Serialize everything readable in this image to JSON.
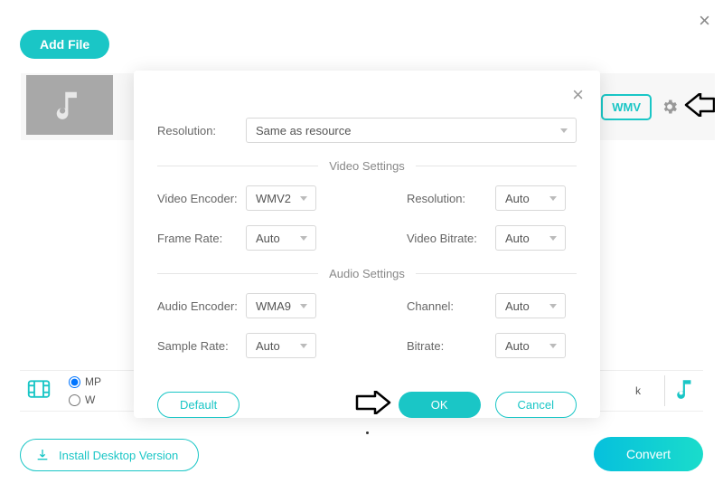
{
  "top": {
    "add_file": "Add File",
    "format_badge": "WMV"
  },
  "modal": {
    "resolution_label": "Resolution:",
    "resolution_value": "Same as resource",
    "video_section": "Video Settings",
    "video_encoder_label": "Video Encoder:",
    "video_encoder_value": "WMV2",
    "frame_rate_label": "Frame Rate:",
    "frame_rate_value": "Auto",
    "res2_label": "Resolution:",
    "res2_value": "Auto",
    "vbitrate_label": "Video Bitrate:",
    "vbitrate_value": "Auto",
    "audio_section": "Audio Settings",
    "audio_encoder_label": "Audio Encoder:",
    "audio_encoder_value": "WMA9",
    "sample_rate_label": "Sample Rate:",
    "sample_rate_value": "Auto",
    "channel_label": "Channel:",
    "channel_value": "Auto",
    "abitrate_label": "Bitrate:",
    "abitrate_value": "Auto",
    "default_btn": "Default",
    "ok_btn": "OK",
    "cancel_btn": "Cancel"
  },
  "bottom": {
    "radio1": "MP",
    "radio2": "W",
    "right_text": "k",
    "install": "Install Desktop Version",
    "convert": "Convert"
  }
}
